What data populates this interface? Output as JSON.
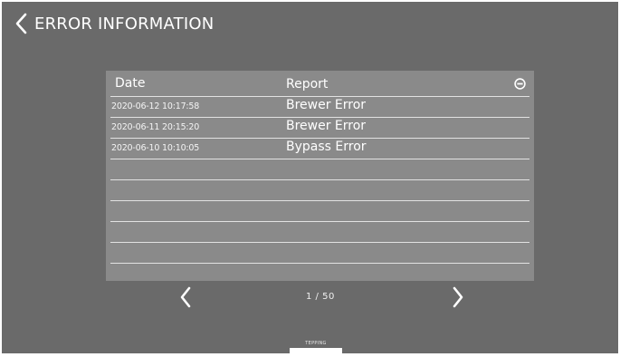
{
  "header": {
    "title": "ERROR INFORMATION",
    "back_icon": "chevron-left-icon"
  },
  "table": {
    "columns": {
      "date": "Date",
      "report": "Report"
    },
    "delete_icon": "minus-circle-icon",
    "rows": [
      {
        "date": "2020-06-12 10:17:58",
        "report": "Brewer Error"
      },
      {
        "date": "2020-06-11 20:15:20",
        "report": "Brewer Error"
      },
      {
        "date": "2020-06-10 10:10:05",
        "report": "Bypass Error"
      },
      {
        "date": "",
        "report": ""
      },
      {
        "date": "",
        "report": ""
      },
      {
        "date": "",
        "report": ""
      },
      {
        "date": "",
        "report": ""
      },
      {
        "date": "",
        "report": ""
      },
      {
        "date": "",
        "report": ""
      }
    ]
  },
  "pagination": {
    "indicator": "1 / 50",
    "prev_icon": "chevron-left-icon",
    "next_icon": "chevron-right-icon"
  },
  "footer": {
    "brand_label": "TEPPING"
  },
  "colors": {
    "screen_background": "#6a6a6a",
    "table_background": "#8a8a8a",
    "text": "#ffffff",
    "divider": "#e2e2e2"
  }
}
